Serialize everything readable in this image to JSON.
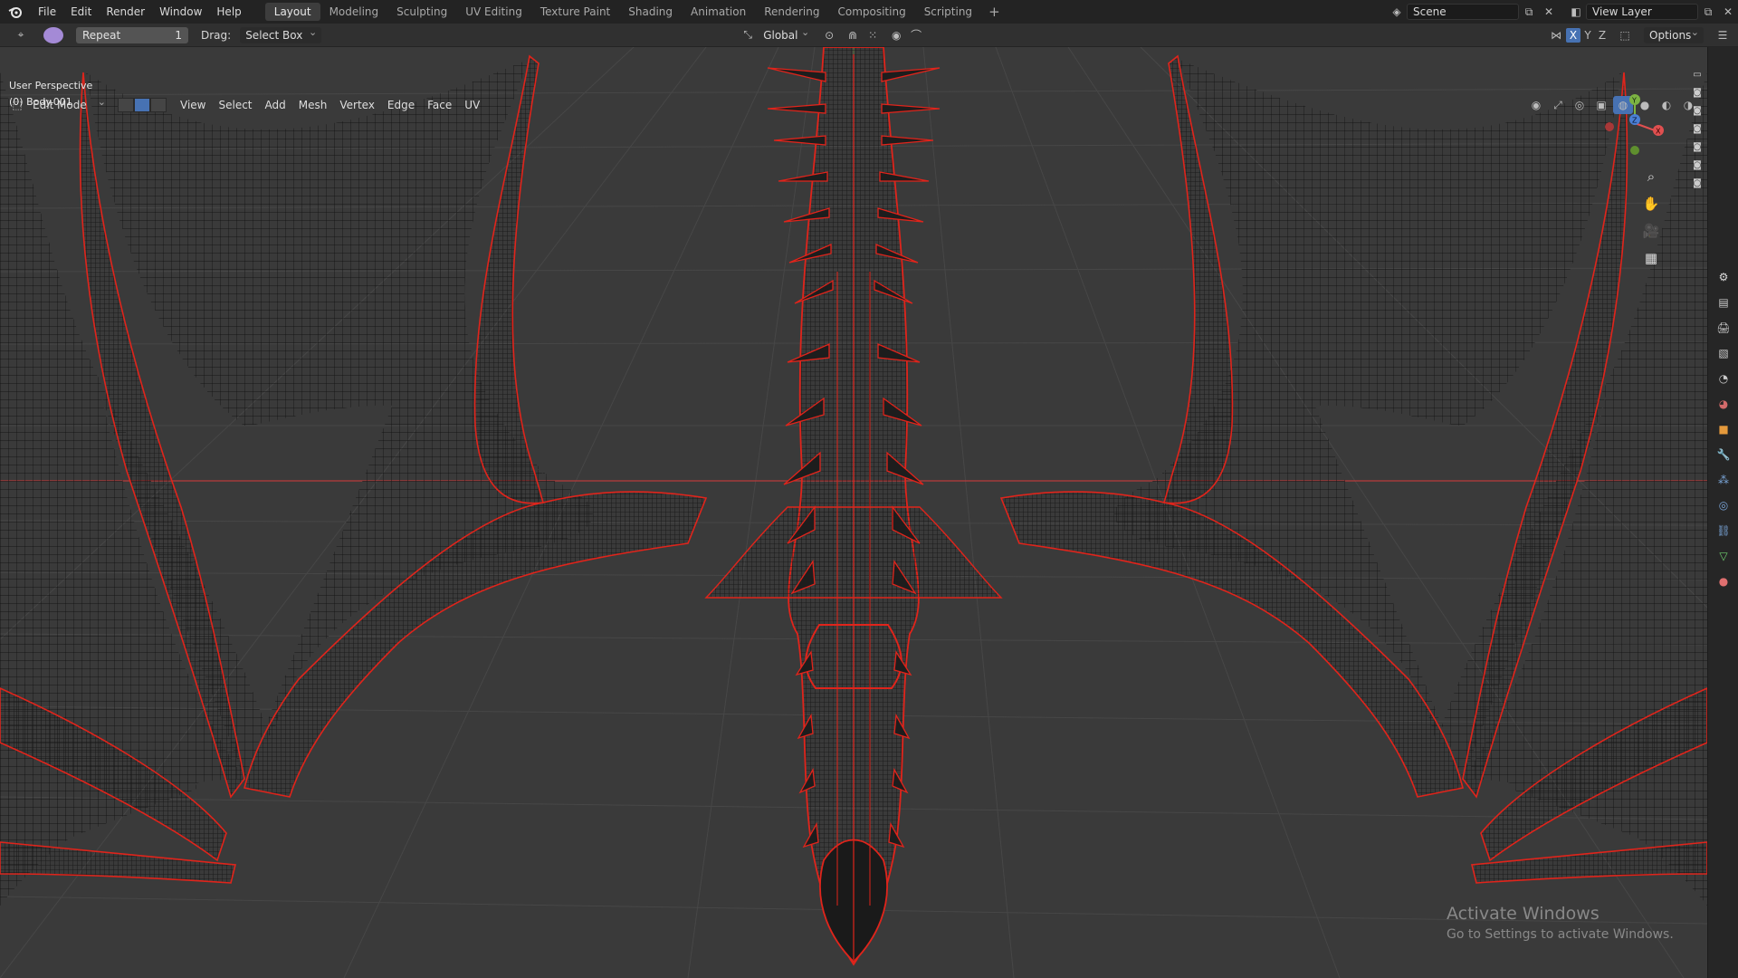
{
  "menu": {
    "items": [
      "File",
      "Edit",
      "Render",
      "Window",
      "Help"
    ]
  },
  "workspaces": {
    "tabs": [
      "Layout",
      "Modeling",
      "Sculpting",
      "UV Editing",
      "Texture Paint",
      "Shading",
      "Animation",
      "Rendering",
      "Compositing",
      "Scripting"
    ],
    "active": "Layout",
    "add_label": "+"
  },
  "top_right": {
    "scene": "Scene",
    "view_layer": "View Layer"
  },
  "toolbar": {
    "repeat_label": "Repeat",
    "repeat_count": "1",
    "drag_label": "Drag:",
    "drag_value": "Select Box",
    "orientation": "Global",
    "options_label": "Options"
  },
  "header": {
    "mode": "Edit Mode",
    "menus": [
      "View",
      "Select",
      "Add",
      "Mesh",
      "Vertex",
      "Edge",
      "Face",
      "UV"
    ],
    "axis_x": "X",
    "axis_y": "Y",
    "axis_z": "Z"
  },
  "viewport": {
    "perspective": "User Perspective",
    "object": "(0) Body.001",
    "gizmo_x": "X",
    "gizmo_y": "Y",
    "gizmo_z": "Z",
    "colors": {
      "background": "#3a3a3a",
      "wire": "#151515",
      "seam": "#e0241b",
      "grid": "#474747"
    }
  },
  "watermark": {
    "line1": "Activate Windows",
    "line2": "Go to Settings to activate Windows."
  }
}
